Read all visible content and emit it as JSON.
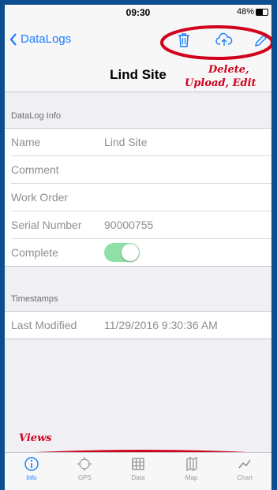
{
  "status_bar": {
    "time": "09:30",
    "battery": "48%"
  },
  "nav": {
    "back_label": "DataLogs",
    "title": "Lind Site",
    "icons": [
      "trash-icon",
      "cloud-upload-icon",
      "pencil-icon"
    ]
  },
  "annotations": {
    "top_line1": "Delete,",
    "top_line2": "Upload, Edit",
    "bottom": "Views"
  },
  "sections": [
    {
      "header": "DataLog Info",
      "rows": [
        {
          "label": "Name",
          "value": "Lind Site"
        },
        {
          "label": "Comment",
          "value": ""
        },
        {
          "label": "Work Order",
          "value": ""
        },
        {
          "label": "Serial Number",
          "value": "90000755"
        },
        {
          "label": "Complete",
          "toggle": true
        }
      ]
    },
    {
      "header": "Timestamps",
      "rows": [
        {
          "label": "Last Modified",
          "value": "11/29/2016 9:30:36 AM"
        }
      ]
    }
  ],
  "tabs": [
    {
      "label": "Info",
      "icon": "info-icon",
      "active": true
    },
    {
      "label": "GPS",
      "icon": "gps-icon",
      "active": false
    },
    {
      "label": "Data",
      "icon": "grid-icon",
      "active": false
    },
    {
      "label": "Map",
      "icon": "map-icon",
      "active": false
    },
    {
      "label": "Chart",
      "icon": "chart-icon",
      "active": false
    }
  ],
  "colors": {
    "accent": "#1a7cff",
    "annotation": "#d0021b",
    "frame": "#0c4e8e",
    "toggle_on": "#8fe0a6"
  }
}
